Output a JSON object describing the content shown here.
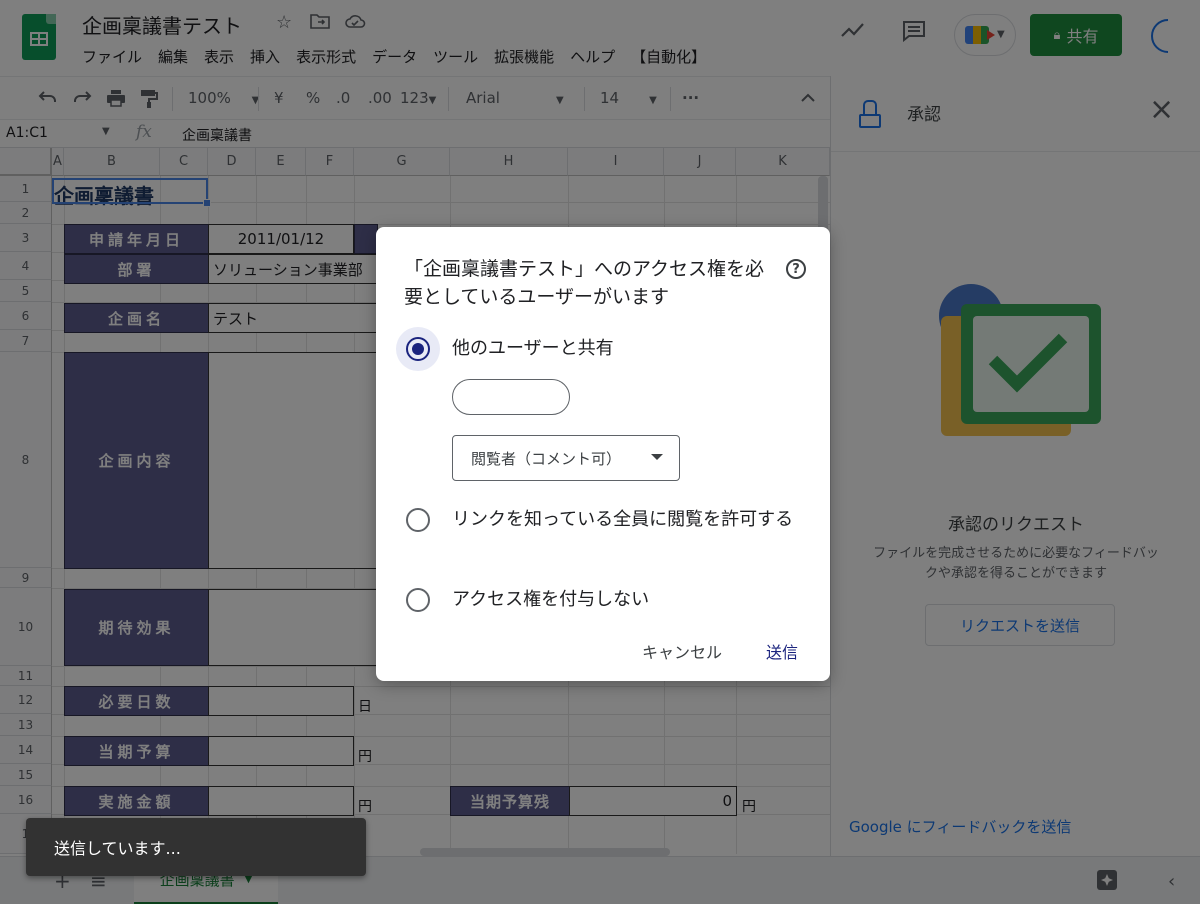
{
  "app": {
    "doc_title": "企画稟議書テスト",
    "menu": [
      "ファイル",
      "編集",
      "表示",
      "挿入",
      "表示形式",
      "データ",
      "ツール",
      "拡張機能",
      "ヘルプ",
      "【自動化】"
    ],
    "share_label": "共有"
  },
  "toolbar": {
    "zoom": "100%",
    "currency": "¥",
    "percent": "%",
    "decimal_dec": ".0",
    "decimal_inc": ".00",
    "format_num": "123",
    "font": "Arial",
    "font_size": "14"
  },
  "formula_bar": {
    "name_box": "A1:C1",
    "fx": "fx",
    "content": "企画稟議書"
  },
  "sheet": {
    "columns": [
      "A",
      "B",
      "C",
      "D",
      "E",
      "F",
      "G",
      "H",
      "I",
      "J",
      "K"
    ],
    "rows": [
      "1",
      "2",
      "3",
      "4",
      "5",
      "6",
      "7",
      "8",
      "9",
      "10",
      "11",
      "12",
      "13",
      "14",
      "15",
      "16",
      "1"
    ],
    "title": "企画稟議書",
    "fields": {
      "apply_date_label": "申請年月日",
      "apply_date_value": "2011/01/12",
      "dept_label": "部署",
      "dept_value": "ソリューション事業部",
      "plan_name_label": "企画名",
      "plan_name_value": "テスト",
      "plan_content_label": "企画内容",
      "effect_label": "期待効果",
      "days_label": "必要日数",
      "days_unit": "日",
      "budget_label": "当期予算",
      "budget_unit": "円",
      "amount_label": "実施金額",
      "amount_unit": "円",
      "remain_label": "当期予算残",
      "remain_value": "0",
      "remain_unit": "円"
    },
    "tab_name": "企画稟議書"
  },
  "side_panel": {
    "title": "承認",
    "heading": "承認のリクエスト",
    "description": "ファイルを完成させるために必要なフィードバックや承認を得ることができます",
    "button": "リクエストを送信",
    "feedback_link": "Google にフィードバックを送信"
  },
  "dialog": {
    "title": "「企画稟議書テスト」へのアクセス権を必要としているユーザーがいます",
    "help": "?",
    "option_share": "他のユーザーと共有",
    "email_value": "",
    "role": "閲覧者（コメント可）",
    "option_link": "リンクを知っている全員に閲覧を許可する",
    "option_none": "アクセス権を付与しない",
    "cancel": "キャンセル",
    "send": "送信"
  },
  "toast": {
    "message": "送信しています..."
  }
}
